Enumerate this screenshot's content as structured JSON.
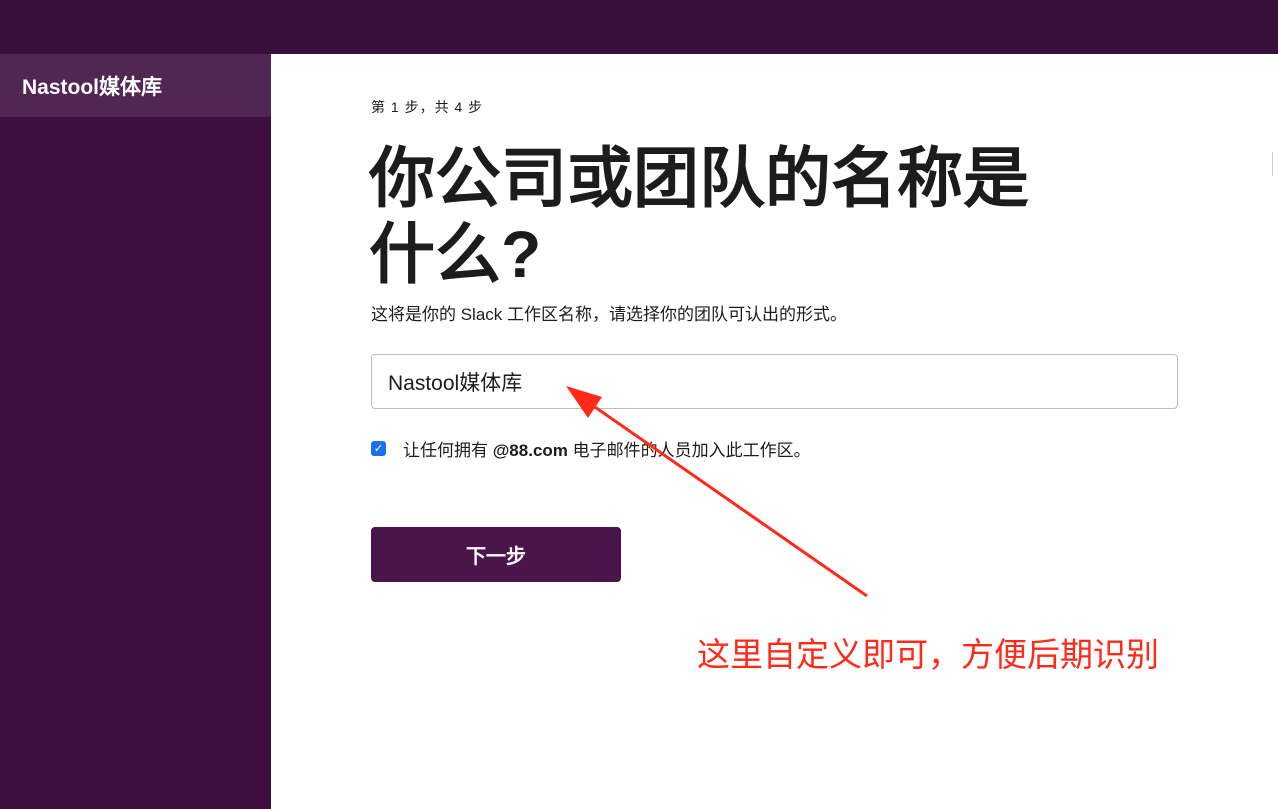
{
  "sidebar": {
    "workspace_name": "Nastool媒体库"
  },
  "main": {
    "step_label": "第 1 步，共 4 步",
    "heading": "你公司或团队的名称是什么?",
    "description": "这将是你的 Slack 工作区名称，请选择你的团队可认出的形式。",
    "name_input": {
      "value": "Nastool媒体库"
    },
    "checkbox": {
      "checked": true,
      "text_before": "让任何拥有 ",
      "domain": "@88.com",
      "text_after": " 电子邮件的人员加入此工作区。"
    },
    "next_button_label": "下一步"
  },
  "annotation": {
    "text": "这里自定义即可，方便后期识别",
    "color": "#ff2a1a"
  },
  "colors": {
    "top_bar": "#3a0e3b",
    "sidebar": "#3f0e40",
    "sidebar_header": "#522653",
    "button": "#4a154b"
  }
}
